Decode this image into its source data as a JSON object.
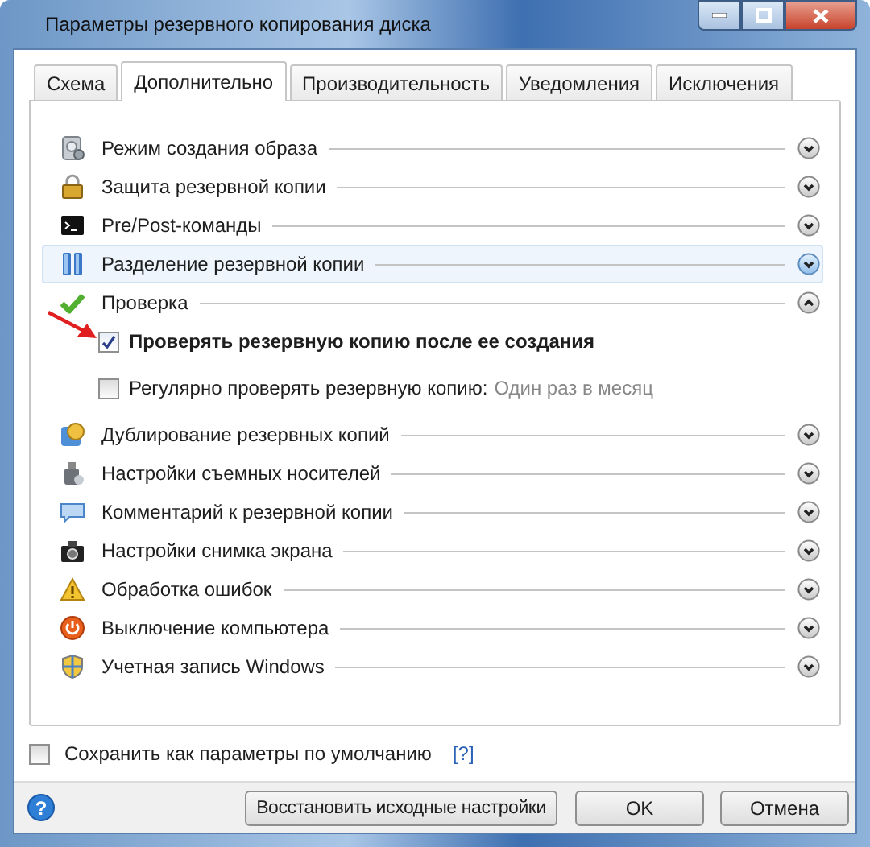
{
  "window": {
    "title": "Параметры резервного копирования диска"
  },
  "tabs": [
    {
      "label": "Схема",
      "selected": false
    },
    {
      "label": "Дополнительно",
      "selected": true
    },
    {
      "label": "Производительность",
      "selected": false
    },
    {
      "label": "Уведомления",
      "selected": false
    },
    {
      "label": "Исключения",
      "selected": false
    }
  ],
  "sections": [
    {
      "label": "Режим создания образа",
      "expanded": false,
      "highlighted": false
    },
    {
      "label": "Защита резервной копии",
      "expanded": false,
      "highlighted": false
    },
    {
      "label": "Pre/Post-команды",
      "expanded": false,
      "highlighted": false
    },
    {
      "label": "Разделение резервной копии",
      "expanded": false,
      "highlighted": true
    },
    {
      "label": "Проверка",
      "expanded": true,
      "highlighted": false,
      "options": [
        {
          "label": "Проверять резервную копию после ее создания",
          "checked": true,
          "emphasized": true,
          "annotation_arrow": true
        },
        {
          "label": "Регулярно проверять резервную копию:",
          "value": "Один раз в месяц",
          "checked": false,
          "emphasized": false,
          "annotation_arrow": false
        }
      ]
    },
    {
      "label": "Дублирование резервных копий",
      "expanded": false,
      "highlighted": false
    },
    {
      "label": "Настройки съемных носителей",
      "expanded": false,
      "highlighted": false
    },
    {
      "label": "Комментарий к резервной копии",
      "expanded": false,
      "highlighted": false
    },
    {
      "label": "Настройки снимка экрана",
      "expanded": false,
      "highlighted": false
    },
    {
      "label": "Обработка ошибок",
      "expanded": false,
      "highlighted": false
    },
    {
      "label": "Выключение компьютера",
      "expanded": false,
      "highlighted": false
    },
    {
      "label": "Учетная запись Windows",
      "expanded": false,
      "highlighted": false
    }
  ],
  "help_icon": "?",
  "save_default": {
    "label": "Сохранить как параметры по умолчанию",
    "checked": false,
    "help": "[?]"
  },
  "buttons": [
    {
      "label": "Восстановить исходные настройки"
    },
    {
      "label": "OK"
    },
    {
      "label": "Отмена"
    }
  ]
}
